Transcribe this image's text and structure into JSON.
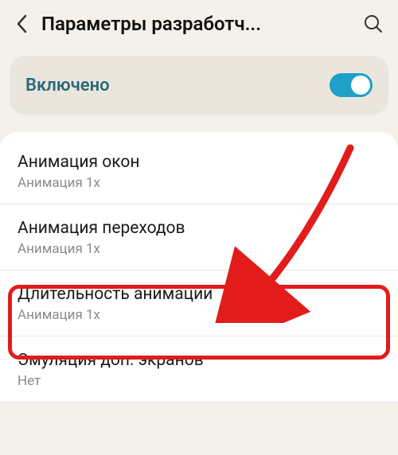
{
  "header": {
    "title": "Параметры разработч..."
  },
  "toggle": {
    "label": "Включено",
    "on": true
  },
  "items": [
    {
      "title": "Анимация окон",
      "sub": "Анимация 1x"
    },
    {
      "title": "Анимация переходов",
      "sub": "Анимация 1x"
    },
    {
      "title": "Длительность анимации",
      "sub": "Анимация 1x"
    },
    {
      "title": "Эмуляция доп. экранов",
      "sub": "Нет"
    }
  ]
}
